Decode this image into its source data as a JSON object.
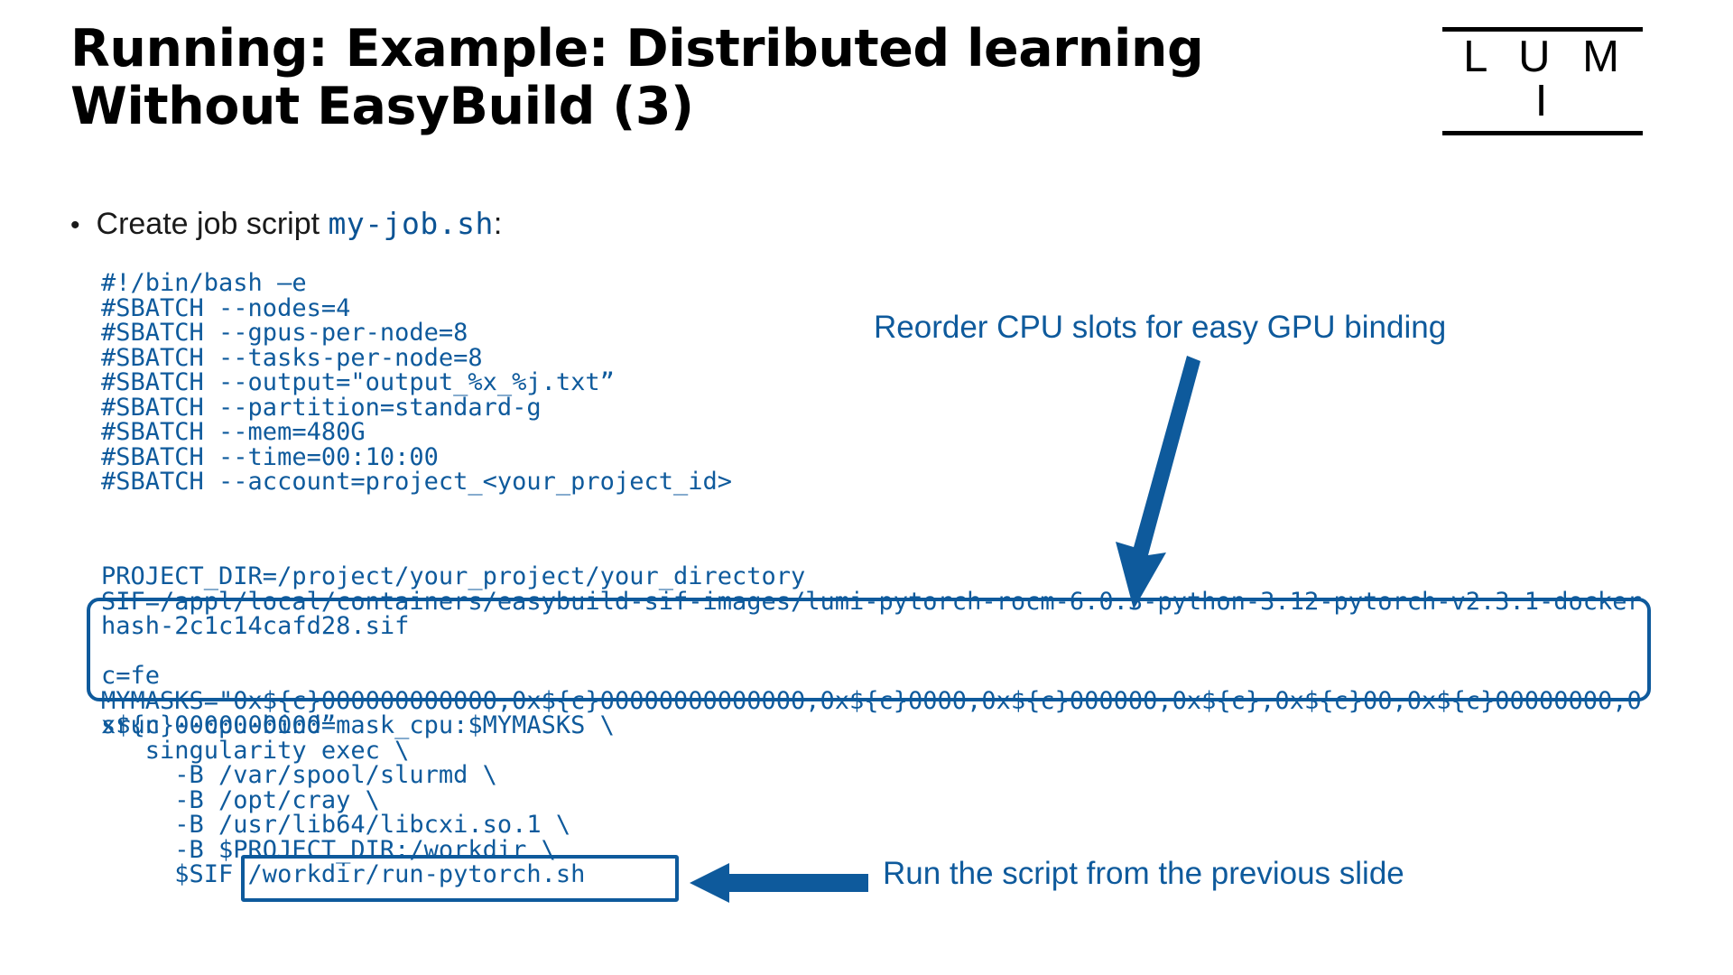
{
  "slide": {
    "title": "Running: Example: Distributed learning\nWithout EasyBuild (3)",
    "logo": {
      "word": "L U M I"
    },
    "bullet": {
      "marker": "•",
      "text_before": "Create job script ",
      "code": "my-job.sh",
      "text_after": ":"
    },
    "code_blocks": {
      "sbatch": "#!/bin/bash –e\n#SBATCH --nodes=4\n#SBATCH --gpus-per-node=8\n#SBATCH --tasks-per-node=8\n#SBATCH --output=\"output_%x_%j.txt”\n#SBATCH --partition=standard-g\n#SBATCH --mem=480G\n#SBATCH --time=00:10:00\n#SBATCH --account=project_<your_project_id>",
      "vars": "PROJECT_DIR=/project/your_project/your_directory\nSIF=/appl/local/containers/easybuild-sif-images/lumi-pytorch-rocm-6.0.3-python-3.12-pytorch-v2.3.1-dockerhash-2c1c14cafd28.sif",
      "masks": "c=fe\nMYMASKS=\"0x${c}000000000000,0x${c}00000000000000,0x${c}0000,0x${c}000000,0x${c},0x${c}00,0x${c}00000000,0x${c}0000000000”",
      "srun": "srun --cpu-bind=mask_cpu:$MYMASKS \\\n   singularity exec \\\n     -B /var/spool/slurmd \\\n     -B /opt/cray \\\n     -B /usr/lib64/libcxi.so.1 \\\n     -B $PROJECT_DIR:/workdir \\\n     $SIF /workdir/run-pytorch.sh"
    },
    "annotations": {
      "reorder": "Reorder CPU slots for easy GPU binding",
      "run": "Run the script from the previous slide"
    },
    "colors": {
      "accent": "#0e5a9c",
      "code": "#0e5a9c",
      "title": "#000000",
      "background": "#ffffff"
    }
  }
}
